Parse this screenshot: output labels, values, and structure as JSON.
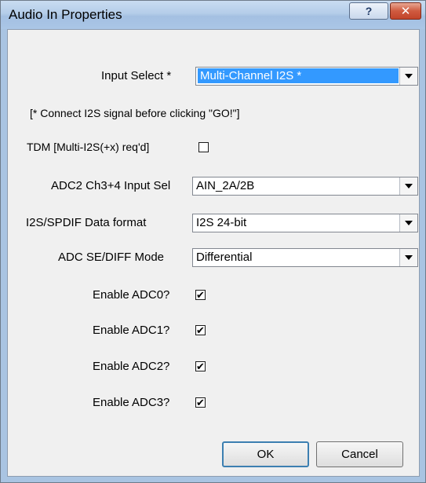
{
  "window": {
    "title": "Audio In Properties",
    "help_glyph": "?",
    "close_glyph": "✕"
  },
  "form": {
    "input_select": {
      "label": "Input Select *",
      "value": "Multi-Channel I2S *"
    },
    "note": "[* Connect I2S signal before clicking \"GO!\"]",
    "tdm": {
      "label": "TDM [Multi-I2S(+x) req'd]",
      "checked": false
    },
    "adc2_input": {
      "label": "ADC2 Ch3+4 Input Sel",
      "value": "AIN_2A/2B"
    },
    "data_format": {
      "label": "I2S/SPDIF Data format",
      "value": "I2S 24-bit"
    },
    "adc_mode": {
      "label": "ADC SE/DIFF Mode",
      "value": "Differential"
    },
    "enable_adc0": {
      "label": "Enable ADC0?",
      "checked": true
    },
    "enable_adc1": {
      "label": "Enable ADC1?",
      "checked": true
    },
    "enable_adc2": {
      "label": "Enable ADC2?",
      "checked": true
    },
    "enable_adc3": {
      "label": "Enable ADC3?",
      "checked": true
    }
  },
  "buttons": {
    "ok": "OK",
    "cancel": "Cancel"
  },
  "check_glyph": "✔"
}
